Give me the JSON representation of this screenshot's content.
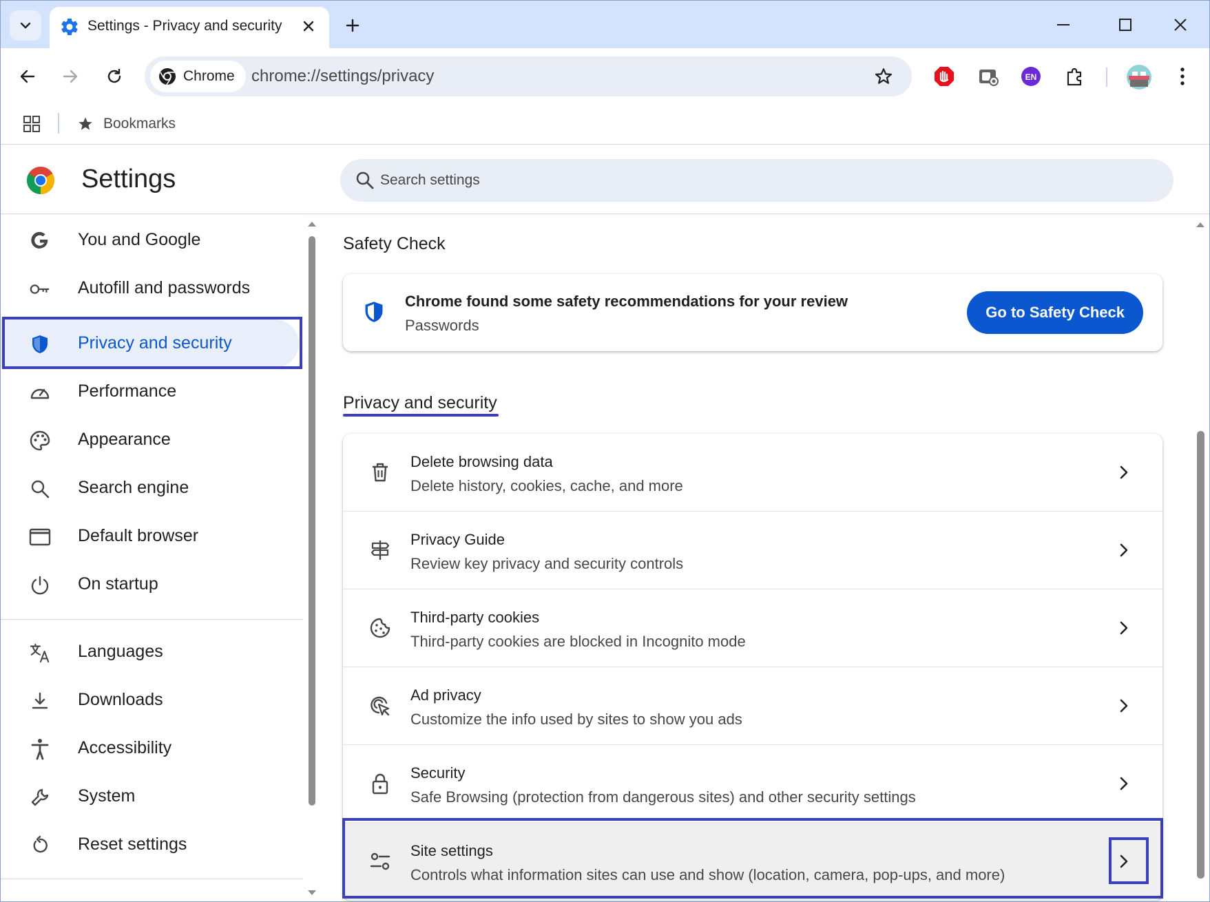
{
  "browser": {
    "tab_title": "Settings - Privacy and security",
    "omnibox_chip": "Chrome",
    "url": "chrome://settings/privacy",
    "extensions": [
      {
        "name": "adblock-extension-icon"
      },
      {
        "name": "screen-capture-extension-icon"
      },
      {
        "name": "language-extension-icon",
        "label": "EN"
      },
      {
        "name": "extensions-puzzle-icon"
      }
    ],
    "bookmarks_label": "Bookmarks"
  },
  "settings": {
    "title": "Settings",
    "search_placeholder": "Search settings"
  },
  "sidebar": {
    "items": [
      {
        "label": "You and Google",
        "icon": "google-g-icon"
      },
      {
        "label": "Autofill and passwords",
        "icon": "key-icon"
      },
      {
        "label": "Privacy and security",
        "icon": "shield-icon",
        "active": true
      },
      {
        "label": "Performance",
        "icon": "speedometer-icon"
      },
      {
        "label": "Appearance",
        "icon": "palette-icon"
      },
      {
        "label": "Search engine",
        "icon": "search-icon"
      },
      {
        "label": "Default browser",
        "icon": "browser-window-icon"
      },
      {
        "label": "On startup",
        "icon": "power-icon"
      },
      {
        "label": "Languages",
        "icon": "translate-icon"
      },
      {
        "label": "Downloads",
        "icon": "download-icon"
      },
      {
        "label": "Accessibility",
        "icon": "accessibility-icon"
      },
      {
        "label": "System",
        "icon": "wrench-icon"
      },
      {
        "label": "Reset settings",
        "icon": "reset-icon"
      }
    ]
  },
  "main": {
    "safety_check": {
      "heading": "Safety Check",
      "title": "Chrome found some safety recommendations for your review",
      "subtitle": "Passwords",
      "button": "Go to Safety Check"
    },
    "privacy": {
      "heading": "Privacy and security",
      "rows": [
        {
          "title": "Delete browsing data",
          "subtitle": "Delete history, cookies, cache, and more",
          "icon": "trash-icon"
        },
        {
          "title": "Privacy Guide",
          "subtitle": "Review key privacy and security controls",
          "icon": "signpost-icon"
        },
        {
          "title": "Third-party cookies",
          "subtitle": "Third-party cookies are blocked in Incognito mode",
          "icon": "cookie-icon"
        },
        {
          "title": "Ad privacy",
          "subtitle": "Customize the info used by sites to show you ads",
          "icon": "ad-target-icon"
        },
        {
          "title": "Security",
          "subtitle": "Safe Browsing (protection from dangerous sites) and other security settings",
          "icon": "lock-icon"
        },
        {
          "title": "Site settings",
          "subtitle": "Controls what information sites can use and show (location, camera, pop-ups, and more)",
          "icon": "tune-icon",
          "selected": true
        }
      ]
    }
  },
  "colors": {
    "accent": "#0b57d0",
    "highlight_box": "#3b3fbc",
    "tabstrip": "#d3e3fd"
  }
}
